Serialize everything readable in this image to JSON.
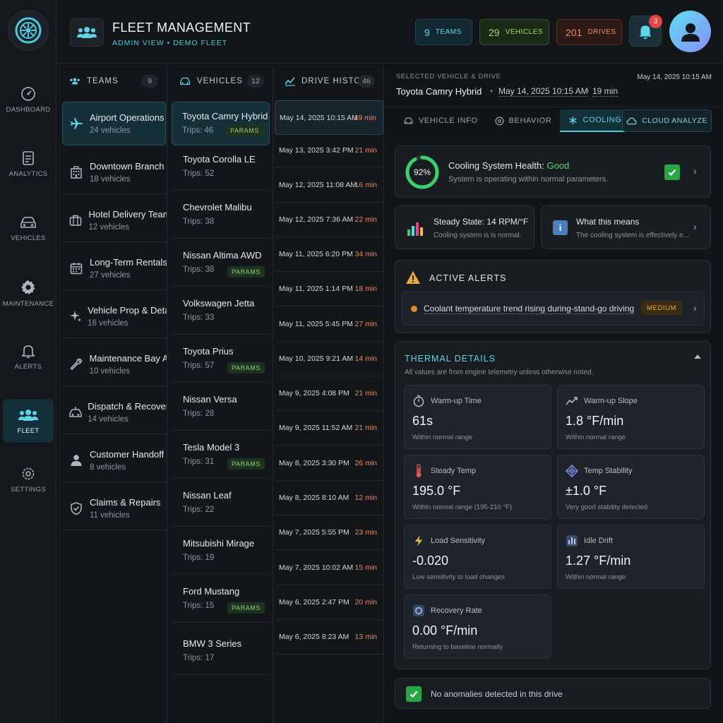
{
  "app": {
    "title": "FLEET MANAGEMENT",
    "subtitle": "ADMIN VIEW • DEMO FLEET"
  },
  "nav": [
    {
      "label": "DASHBOARD",
      "icon": "dashboard-icon"
    },
    {
      "label": "ANALYTICS",
      "icon": "analytics-icon"
    },
    {
      "label": "VEHICLES",
      "icon": "car-icon"
    },
    {
      "label": "MAINTENANCE",
      "icon": "gear-icon"
    },
    {
      "label": "ALERTS",
      "icon": "bell-icon"
    },
    {
      "label": "FLEET",
      "icon": "people-icon",
      "active": true
    },
    {
      "label": "SETTINGS",
      "icon": "settings-icon"
    }
  ],
  "stats": {
    "teams": {
      "value": "9",
      "label": "TEAMS"
    },
    "vehicles": {
      "value": "29",
      "label": "VEHICLES"
    },
    "drives": {
      "value": "201",
      "label": "DRIVES"
    },
    "notifications": "3"
  },
  "teams": {
    "header": "TEAMS",
    "count": "9",
    "items": [
      {
        "name": "Airport Operations",
        "sub": "24 vehicles",
        "icon": "plane-icon"
      },
      {
        "name": "Downtown Branch",
        "sub": "18 vehicles",
        "icon": "building-icon"
      },
      {
        "name": "Hotel Delivery Team",
        "sub": "12 vehicles",
        "icon": "luggage-icon"
      },
      {
        "name": "Long-Term Rentals",
        "sub": "27 vehicles",
        "icon": "calendar-icon"
      },
      {
        "name": "Vehicle Prop & Detail",
        "sub": "16 vehicles",
        "icon": "sparkle-icon"
      },
      {
        "name": "Maintenance Bay A",
        "sub": "10 vehicles",
        "icon": "wrench-icon"
      },
      {
        "name": "Dispatch & Recovery",
        "sub": "14 vehicles",
        "icon": "tow-car-icon"
      },
      {
        "name": "Customer Handoff",
        "sub": "8 vehicles",
        "icon": "person-icon"
      },
      {
        "name": "Claims & Repairs",
        "sub": "11 vehicles",
        "icon": "shield-check-icon"
      }
    ]
  },
  "vehicles": {
    "header": "VEHICLES",
    "count": "12",
    "params_label": "PARAMS",
    "items": [
      {
        "name": "Toyota Camry Hybrid",
        "sub": "Trips: 46",
        "params": true
      },
      {
        "name": "Toyota Corolla LE",
        "sub": "Trips: 52",
        "params": false
      },
      {
        "name": "Chevrolet Malibu",
        "sub": "Trips: 38",
        "params": false
      },
      {
        "name": "Nissan Altima AWD",
        "sub": "Trips: 38",
        "params": true
      },
      {
        "name": "Volkswagen Jetta",
        "sub": "Trips: 33",
        "params": false
      },
      {
        "name": "Toyota Prius",
        "sub": "Trips: 57",
        "params": true
      },
      {
        "name": "Nissan Versa",
        "sub": "Trips: 28",
        "params": false
      },
      {
        "name": "Tesla Model 3",
        "sub": "Trips: 31",
        "params": true
      },
      {
        "name": "Nissan Leaf",
        "sub": "Trips: 22",
        "params": false
      },
      {
        "name": "Mitsubishi Mirage",
        "sub": "Trips: 19",
        "params": false
      },
      {
        "name": "Ford Mustang",
        "sub": "Trips: 15",
        "params": true
      },
      {
        "name": "BMW 3 Series",
        "sub": "Trips: 17",
        "params": false
      }
    ]
  },
  "drives": {
    "header": "DRIVE HISTORY",
    "count": "46",
    "items": [
      {
        "date": "May 14, 2025  10:15 AM",
        "dur": "19 min"
      },
      {
        "date": "May 13, 2025  3:42 PM",
        "dur": "21 min"
      },
      {
        "date": "May 12, 2025  11:08 AM",
        "dur": "16 min"
      },
      {
        "date": "May 12, 2025  7:36 AM",
        "dur": "22 min"
      },
      {
        "date": "May 11, 2025  6:20 PM",
        "dur": "34 min"
      },
      {
        "date": "May 11, 2025  1:14 PM",
        "dur": "18 min"
      },
      {
        "date": "May 11, 2025  5:45 PM",
        "dur": "27 min"
      },
      {
        "date": "May 10, 2025  9:21 AM",
        "dur": "14 min"
      },
      {
        "date": "May 9, 2025  4:08 PM",
        "dur": "21 min"
      },
      {
        "date": "May 9, 2025  11:52 AM",
        "dur": "21 min"
      },
      {
        "date": "May 8, 2025  3:30 PM",
        "dur": "26 min"
      },
      {
        "date": "May 8, 2025  8:10 AM",
        "dur": "12 min"
      },
      {
        "date": "May 7, 2025  5:55 PM",
        "dur": "23 min"
      },
      {
        "date": "May 7, 2025  10:02 AM",
        "dur": "15 min"
      },
      {
        "date": "May 6, 2025  2:47 PM",
        "dur": "20 min"
      },
      {
        "date": "May 6, 2025  8:23 AM",
        "dur": "13 min"
      }
    ]
  },
  "detail": {
    "label": "SELECTED VEHICLE & DRIVE",
    "vehicle": "Toyota Camry Hybrid",
    "date": "May 14, 2025 10:15 AM",
    "duration": "19 min",
    "timestamp": "May 14, 2025  10:15 AM",
    "tabs": [
      "VEHICLE INFO",
      "BEHAVIOR",
      "COOLING"
    ],
    "active_tab": "COOLING",
    "cloud_button": "CLOUD ANALYZE",
    "health": {
      "percent": "92%",
      "percent_value": 92,
      "title_prefix": "Cooling System Health:",
      "status": "Good",
      "desc": "System is operating within normal parameters."
    },
    "steady": {
      "title": "Steady State: 14 RPM/°F",
      "desc": "Cooling system is is normal."
    },
    "means": {
      "title": "What this means",
      "desc": "The cooling system is effectively e..."
    },
    "alerts": {
      "title": "ACTIVE ALERTS",
      "items": [
        {
          "text": "Coolant temperature trend rising during-stand-go driving",
          "severity": "MEDIUM"
        }
      ]
    },
    "thermal": {
      "title": "THERMAL DETAILS",
      "note": "All values are from engine telemetry unless otherwise noted.",
      "metrics": [
        {
          "label": "Warm-up Time",
          "value": "61s",
          "sub": "Within normal range",
          "icon": "stopwatch-icon"
        },
        {
          "label": "Warm-up Slope",
          "value": "1.8 °F/min",
          "sub": "Within normal range",
          "icon": "trend-icon"
        },
        {
          "label": "Steady Temp",
          "value": "195.0 °F",
          "sub": "Within normal range (195-210 °F)",
          "icon": "thermometer-icon"
        },
        {
          "label": "Temp Stability",
          "value": "±1.0 °F",
          "sub": "Very good stability detected",
          "icon": "stability-icon"
        },
        {
          "label": "Load Sensitivity",
          "value": "-0.020",
          "sub": "Low sensitivity to load changes",
          "icon": "bolt-icon"
        },
        {
          "label": "Idle Drift",
          "value": "1.27 °F/min",
          "sub": "Within normal range",
          "icon": "bars-icon"
        },
        {
          "label": "Recovery Rate",
          "value": "0.00 °F/min",
          "sub": "Returning to baseline normally",
          "icon": "recovery-icon"
        }
      ]
    },
    "no_anomalies": "No anomalies detected in this drive"
  },
  "colors": {
    "accent": "#4fc9dd",
    "good": "#5cd67a",
    "warning": "#e8a83a",
    "duration": "#f08866"
  }
}
